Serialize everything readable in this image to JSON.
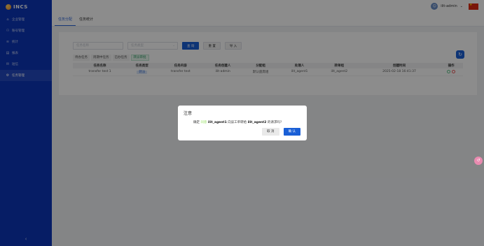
{
  "sidebar": {
    "logo": "INCS",
    "items": [
      {
        "icon": "home-icon",
        "glyph": "⌂",
        "label": "企业管理"
      },
      {
        "icon": "account-icon",
        "glyph": "⚇",
        "label": "账号管理"
      },
      {
        "icon": "chart-icon",
        "glyph": "≋",
        "label": "统计"
      },
      {
        "icon": "doc-icon",
        "glyph": "▤",
        "label": "报表"
      },
      {
        "icon": "mail-icon",
        "glyph": "✉",
        "label": "短信"
      },
      {
        "icon": "task-icon",
        "glyph": "⚙",
        "label": "任务管理"
      }
    ],
    "active_index": 5,
    "collapse_glyph": "‹"
  },
  "topbar": {
    "user": "ilit-admin",
    "dropdown_glyph": "⌄"
  },
  "tabs": [
    {
      "label": "任务分配"
    },
    {
      "label": "任务统计"
    }
  ],
  "filters": {
    "name_placeholder": "任务名称",
    "type_placeholder": "任务类型",
    "search_label": "查 询",
    "reset_label": "重 置",
    "import_label": "导 入"
  },
  "subtabs": [
    {
      "label": "待办任务"
    },
    {
      "label": "周期中任务"
    },
    {
      "label": "已办任务"
    },
    {
      "label": "转派审批"
    }
  ],
  "table": {
    "headers": [
      "任务名称",
      "任务类型",
      "任务内容",
      "任务创建人",
      "分配组",
      "处理人",
      "转单组",
      "创建时间",
      "操作"
    ],
    "rows": [
      {
        "name": "transfer test 1",
        "type": "转派",
        "content": "transfer test",
        "creator": "ilit-admin",
        "group": "默认座席组",
        "handler": "ilit_agent1",
        "transfer": "ilit_agent2",
        "time": "2025-02-18 16:41:37"
      }
    ]
  },
  "dialog": {
    "title": "注意",
    "msg_pre": "确定",
    "msg_highlight": "同意",
    "msg_agent1": "ilit_agent1",
    "msg_mid": "向该工单转给",
    "msg_agent2": "ilit_agent2",
    "msg_post": "的请求吗?",
    "cancel_label": "取 消",
    "confirm_label": "确 认"
  }
}
